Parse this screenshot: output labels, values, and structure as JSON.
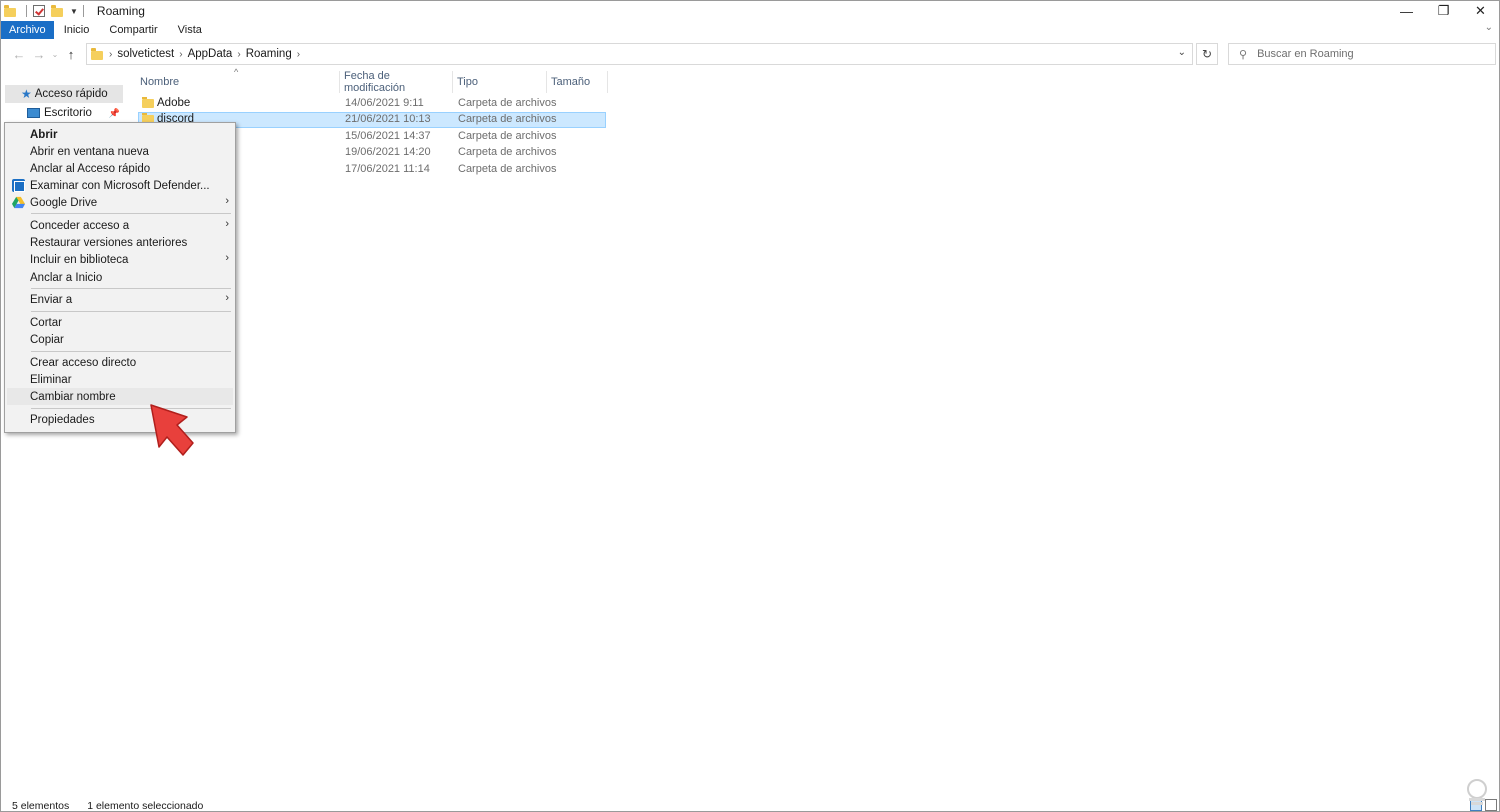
{
  "window": {
    "title": "Roaming",
    "controls": {
      "minimize": "—",
      "maximize": "❐",
      "close": "✕"
    }
  },
  "ribbon": {
    "tabs": [
      "Archivo",
      "Inicio",
      "Compartir",
      "Vista"
    ]
  },
  "address": {
    "crumbs": [
      "solvetictest",
      "AppData",
      "Roaming"
    ],
    "search_placeholder": "Buscar en Roaming"
  },
  "nav_pane": {
    "quick_access": "Acceso rápido",
    "desktop": "Escritorio"
  },
  "columns": {
    "name": "Nombre",
    "date": "Fecha de modificación",
    "type": "Tipo",
    "size": "Tamaño"
  },
  "files": [
    {
      "name": "Adobe",
      "date": "14/06/2021 9:11",
      "type": "Carpeta de archivos",
      "selected": false
    },
    {
      "name": "discord",
      "date": "21/06/2021 10:13",
      "type": "Carpeta de archivos",
      "selected": true
    },
    {
      "name": "",
      "date": "15/06/2021 14:37",
      "type": "Carpeta de archivos",
      "selected": false
    },
    {
      "name": "",
      "date": "19/06/2021 14:20",
      "type": "Carpeta de archivos",
      "selected": false
    },
    {
      "name": "",
      "date": "17/06/2021 11:14",
      "type": "Carpeta de archivos",
      "selected": false
    }
  ],
  "context_menu": {
    "open": "Abrir",
    "open_new_window": "Abrir en ventana nueva",
    "pin_quick_access": "Anclar al Acceso rápido",
    "defender": "Examinar con Microsoft Defender...",
    "google_drive": "Google Drive",
    "give_access": "Conceder acceso a",
    "restore_versions": "Restaurar versiones anteriores",
    "include_library": "Incluir en biblioteca",
    "pin_start": "Anclar a Inicio",
    "send_to": "Enviar a",
    "cut": "Cortar",
    "copy": "Copiar",
    "create_shortcut": "Crear acceso directo",
    "delete": "Eliminar",
    "rename": "Cambiar nombre",
    "properties": "Propiedades"
  },
  "status": {
    "items": "5 elementos",
    "selected": "1 elemento seleccionado"
  },
  "colors": {
    "accent": "#1a6ec6",
    "selection": "#cce8ff",
    "cursor_red": "#e8403c"
  }
}
